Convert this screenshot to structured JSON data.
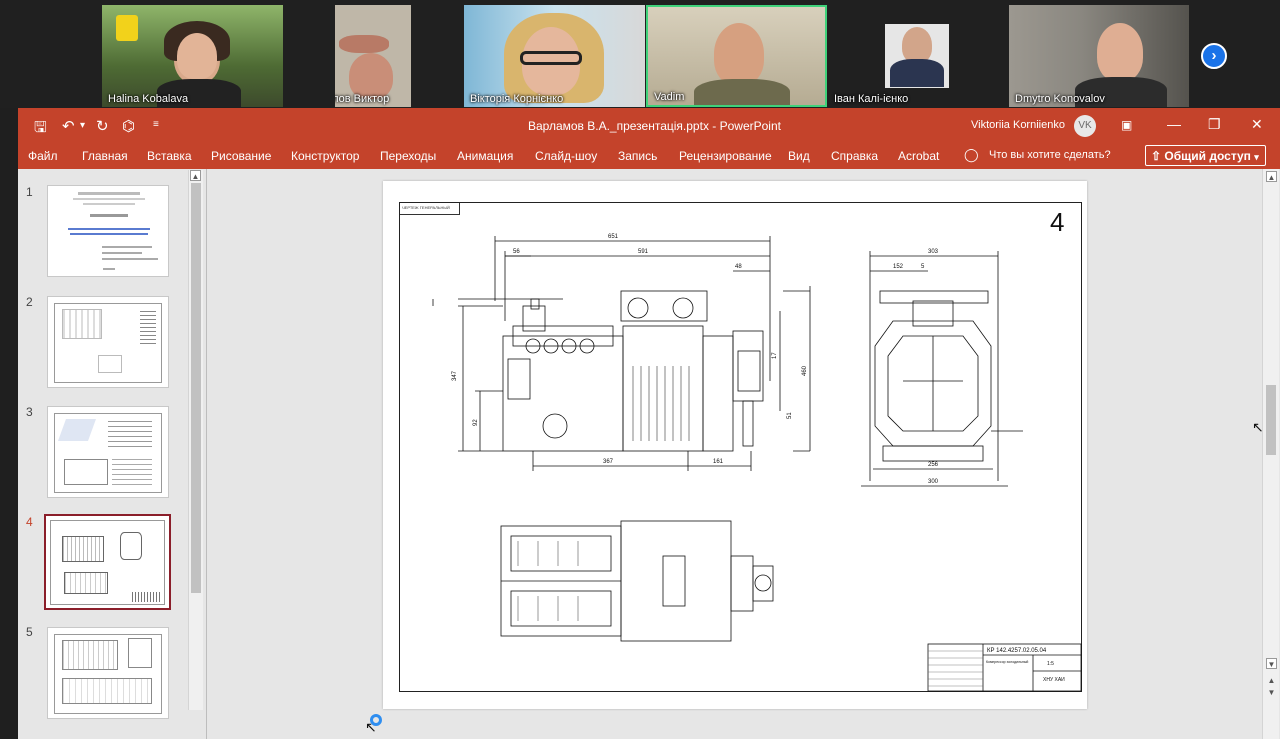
{
  "participants": [
    {
      "name": "Halina Kobalava"
    },
    {
      "name": "Самохвалов Виктор"
    },
    {
      "name": "Вікторія Корнієнко"
    },
    {
      "name": "Vadim"
    },
    {
      "name": "Іван Калі-ієнко"
    },
    {
      "name": "Dmytro Konovalov"
    }
  ],
  "ppt": {
    "title": "Варламов В.А._презентація.pptx  -  PowerPoint",
    "user_name": "Viktoriia Korniienko",
    "user_initials": "VK",
    "ribbon_tabs": [
      "Файл",
      "Главная",
      "Вставка",
      "Рисование",
      "Конструктор",
      "Переходы",
      "Анимация",
      "Слайд-шоу",
      "Запись",
      "Рецензирование",
      "Вид",
      "Справка",
      "Acrobat"
    ],
    "tell_me": "Что вы хотите сделать?",
    "share": "Общий доступ",
    "thumb_numbers": [
      "1",
      "2",
      "3",
      "4",
      "5"
    ],
    "active_slide": "4"
  },
  "slide": {
    "number": "4",
    "stamp": "ЧЕРТЕЖ ГЕНЕРАЛЬНЫЙ",
    "dims": {
      "d651": "651",
      "d591": "591",
      "d56": "56",
      "d48": "48",
      "d347": "347",
      "d92": "92",
      "d367": "367",
      "d161": "161",
      "d303": "303",
      "d152": "152",
      "d5": "5",
      "d256": "256",
      "d300": "300",
      "d17": "17",
      "d460": "460",
      "d51": "51"
    },
    "title_block": {
      "code": "КР 142.4257.02.05.04",
      "desc": "Компрессор холодильный",
      "scale": "1:5",
      "org": "ХНУ ХАИ"
    }
  },
  "colors": {
    "accent": "#c4432b",
    "share_blue": "#1a73e8"
  }
}
